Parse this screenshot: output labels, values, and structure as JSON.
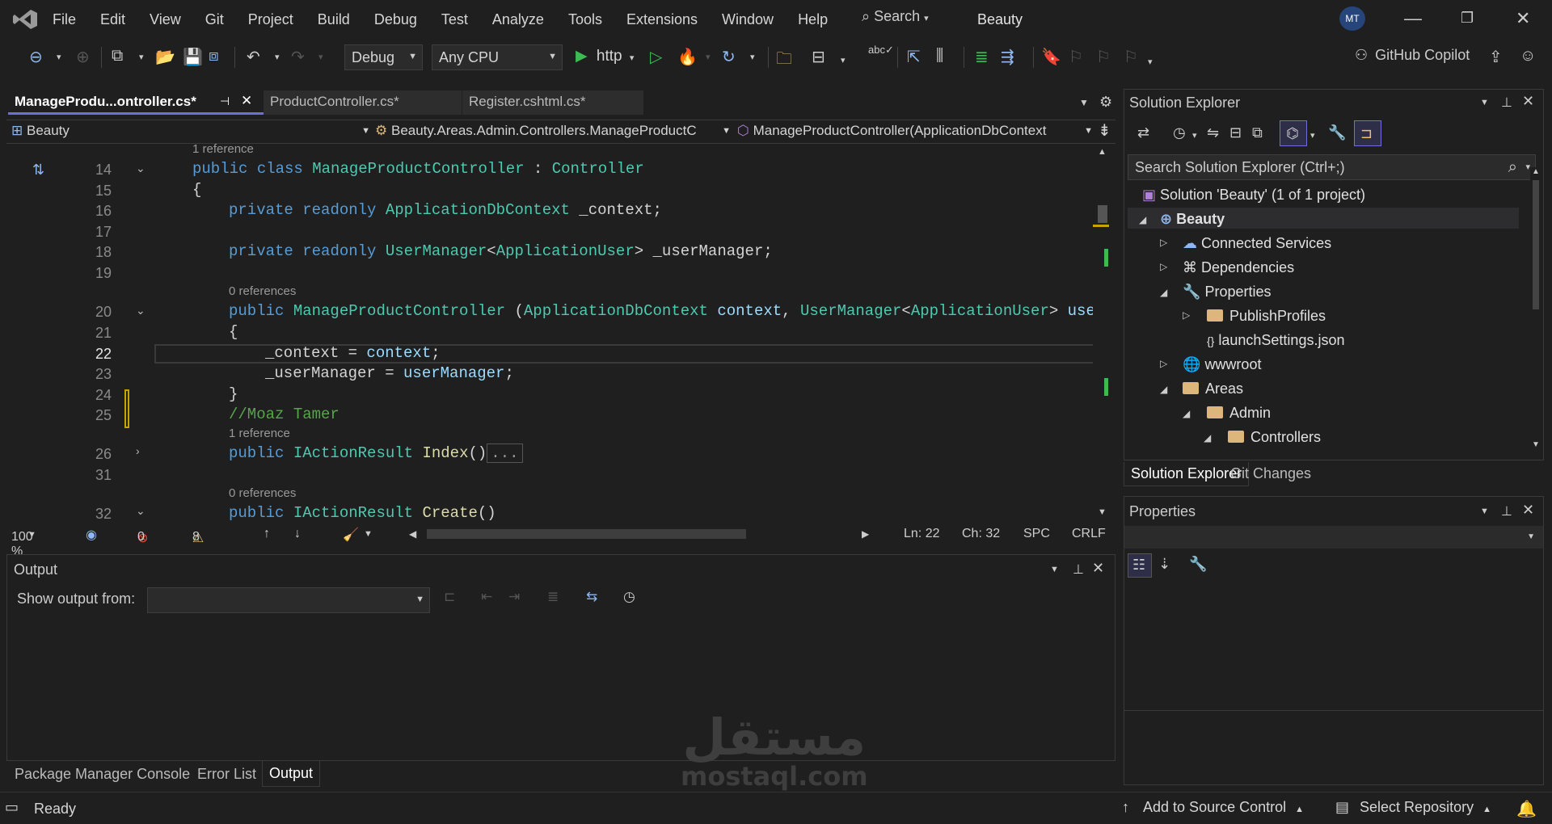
{
  "menu": [
    "File",
    "Edit",
    "View",
    "Git",
    "Project",
    "Build",
    "Debug",
    "Test",
    "Analyze",
    "Tools",
    "Extensions",
    "Window",
    "Help"
  ],
  "search_label": "Search",
  "solution_title": "Beauty",
  "avatar_initials": "MT",
  "toolbar": {
    "config": "Debug",
    "platform": "Any CPU",
    "run_profile": "http",
    "copilot": "GitHub Copilot"
  },
  "tabs": [
    {
      "label": "ManageProdu...ontroller.cs*",
      "active": true
    },
    {
      "label": "ProductController.cs*",
      "active": false
    },
    {
      "label": "Register.cshtml.cs*",
      "active": false
    }
  ],
  "navbar": {
    "project": "Beauty",
    "type": "Beauty.Areas.Admin.Controllers.ManageProductC",
    "member": "ManageProductController(ApplicationDbContext"
  },
  "code": {
    "ref_top": "1 reference",
    "ref_ctor": "0 references",
    "ref_index": "1 reference",
    "ref_create": "0 references",
    "lines": {
      "l14": "14",
      "l15": "15",
      "l16": "16",
      "l17": "17",
      "l18": "18",
      "l19": "19",
      "l20": "20",
      "l21": "21",
      "l22": "22",
      "l23": "23",
      "l24": "24",
      "l25": "25",
      "l26": "26",
      "l31": "31",
      "l32": "32"
    },
    "comment": "//Moaz Tamer"
  },
  "editor_status": {
    "zoom": "100 %",
    "errors": "0",
    "warnings": "8",
    "line": "Ln: 22",
    "col": "Ch: 32",
    "spacing": "SPC",
    "eol": "CRLF"
  },
  "output": {
    "title": "Output",
    "show_from": "Show output from:"
  },
  "bottom_tabs": [
    "Package Manager Console",
    "Error List",
    "Output"
  ],
  "solution_explorer": {
    "title": "Solution Explorer",
    "search_placeholder": "Search Solution Explorer (Ctrl+;)",
    "items": [
      {
        "label": "Solution 'Beauty' (1 of 1 project)"
      },
      {
        "label": "Beauty"
      },
      {
        "label": "Connected Services"
      },
      {
        "label": "Dependencies"
      },
      {
        "label": "Properties"
      },
      {
        "label": "PublishProfiles"
      },
      {
        "label": "launchSettings.json"
      },
      {
        "label": "wwwroot"
      },
      {
        "label": "Areas"
      },
      {
        "label": "Admin"
      },
      {
        "label": "Controllers"
      }
    ],
    "tabs": [
      "Solution Explorer",
      "Git Changes"
    ]
  },
  "properties_title": "Properties",
  "statusbar": {
    "ready": "Ready",
    "source_control": "Add to Source Control",
    "repo": "Select Repository"
  },
  "watermark": {
    "arabic": "مستقل",
    "latin": "mostaql.com"
  }
}
